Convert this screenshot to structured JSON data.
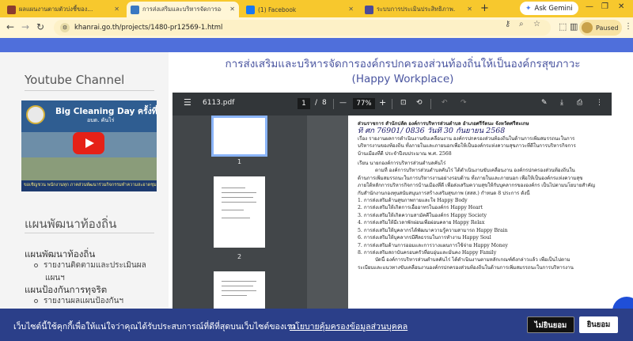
{
  "browser": {
    "tabs": [
      {
        "title": "ผลแผนงานตามตัวบ่งชี้ของ...",
        "icon_color": "#8a3b2f",
        "active": false
      },
      {
        "title": "การส่งเสริมและบริหารจัดการองค์กร",
        "icon_color": "#3a78c2",
        "active": true
      },
      {
        "title": "(1) Facebook",
        "icon_color": "#1877f2",
        "active": false
      },
      {
        "title": "ระบบการประเมินประสิทธิภาพ...",
        "icon_color": "#4a4a9a",
        "active": false
      }
    ],
    "new_tab": "+",
    "ask_gemini": "Ask Gemini",
    "url": "khanrai.go.th/projects/1480-pr12569-1.html",
    "profile_status": "Paused"
  },
  "sidebar": {
    "youtube_heading": "Youtube Channel",
    "video": {
      "title": "Big Cleaning Day ครั้งที่",
      "subtitle": "อบต. คันไร่",
      "caption": "ขอเชิญชวน พนักงานทุก ภาคส่วนพัฒนาร่วมกิจกรรมทำความสะอาดชุมชน ท้องถิ่นของเรา"
    },
    "plan_heading": "แผนพัฒนาท้องถิ่น",
    "items": [
      {
        "label": "แผนพัฒนาท้องถิ่น",
        "sub": [
          "รายงานติดตามและประเมินผล",
          "แผนฯ"
        ]
      },
      {
        "label": "แผนป้องกันการทุจริต",
        "sub": [
          "รายงานผลแผนป้องกันฯ"
        ]
      }
    ]
  },
  "main": {
    "title_line1": "การส่งเสริมและบริหารจัดการองค์กรปกครองส่วนท้องถิ่นให้เป็นองค์กรสุขภาวะ",
    "title_line2": "(Happy Workplace)"
  },
  "pdf": {
    "filename": "6113.pdf",
    "current_page": "1",
    "page_sep": "/",
    "total_pages": "8",
    "zoom": "77%",
    "thumbnails": [
      "1",
      "2"
    ],
    "doc_lines": [
      {
        "text": "ส่วนราชการ     สำนักปลัด องค์การบริหารส่วนตำบล อำเภอศรีรัตนะ จังหวัดศรีสะเกษ",
        "style": "b"
      },
      {
        "text": "ที่  ศก 76901/ 0836                        วันที่  30  กันยายน  2568",
        "style": "hw"
      },
      {
        "text": "เรื่อง   รายงานผลการดำเนินงานขับเคลื่อนงาน องค์กรปกครองส่วนท้องถิ่นในด้านการเพิ่มสมรรถนะในการ",
        "style": ""
      },
      {
        "text": "บริหารงานของท้องถิ่น ทั้งภายในและภายนอกเพื่อให้เป็นองค์กรแห่งความสุขภาวะที่ดีในการบริหารกิจการ",
        "style": ""
      },
      {
        "text": "บ้านเมืองที่ดี ประจำปีงบประมาณ พ.ศ. 2568",
        "style": ""
      },
      {
        "text": "เรียน    นายกองค์การบริหารส่วนตำบลคันไร่",
        "style": ""
      },
      {
        "text": "ตามที่ องค์การบริหารส่วนตำบลคันไร่ ได้ดำเนินงานขับเคลื่อนงาน องค์กรปกครองส่วนท้องถิ่นใน",
        "style": "ind"
      },
      {
        "text": "ด้านการเพิ่มสมรรถนะในการบริหารงานอย่างรอบด้าน ทั้งภายในและภายนอก เพื่อให้เป็นองค์กรแห่งความสุข",
        "style": ""
      },
      {
        "text": "ภายใต้หลักการบริหารกิจการบ้านเมืองที่ดี เพื่อส่งเสริมความสุขให้กับบุคลากรขององค์กร เป็นไปตามนโยบายสำคัญ",
        "style": ""
      },
      {
        "text": "กับสำนักงานกองทุนสนับสนุนการสร้างเสริมสุขภาพ (สสส.) กำหนด 8 ประการ ดังนี้",
        "style": ""
      },
      {
        "text": "1. การส่งเสริมด้านสุขภาพกายและใจ Happy Body",
        "style": ""
      },
      {
        "text": "2. การส่งเสริมให้เกิดการเอื้ออาทรในองค์กร Happy Heart",
        "style": ""
      },
      {
        "text": "3. การส่งเสริมให้เกิดความสามัคคีในองค์กร Happy Society",
        "style": ""
      },
      {
        "text": "4. การส่งเสริมให้มีเวลาพักผ่อนเพื่อผ่อนคลาย Happy Relax",
        "style": ""
      },
      {
        "text": "5. การส่งเสริมให้บุคลากรได้พัฒนาความรู้ความสามารถ Happy Brain",
        "style": ""
      },
      {
        "text": "6. การส่งเสริมให้บุคลากรมีศีลธรรมในการทำงาน Happy Soul",
        "style": ""
      },
      {
        "text": "7. การส่งเสริมด้านการออมและการวางแผนการใช้จ่าย Happy Money",
        "style": ""
      },
      {
        "text": "8. การส่งเสริมสถาบันครอบครัวที่อบอุ่นและมั่นคง Happy Family",
        "style": ""
      },
      {
        "text": "บัดนี้  องค์การบริหารส่วนตำบลคันไร่ ได้ดำเนินงานตามหลักเกณฑ์ดังกล่าวแล้ว เพื่อเป็นไปตาม",
        "style": "ind"
      },
      {
        "text": "ระเบียบและแนวทางขับเคลื่อนงานองค์กรปกครองส่วนท้องถิ่นในด้านการเพิ่มสมรรถนะในการบริหารงาน",
        "style": ""
      }
    ]
  },
  "cookie": {
    "message": "เว็บไซต์นี้ใช้คุกกี้เพื่อให้แน่ใจว่าคุณได้รับประสบการณ์ที่ดีที่สุดบนเว็บไซต์ของเรา",
    "policy_link": "นโยบายคุ้มครองข้อมูลส่วนบุคคล",
    "decline": "ไม่ยินยอม",
    "accept": "ยินยอม"
  },
  "colors": {
    "tabbar": "#f7c82d",
    "accent_blue": "#4f6fdb",
    "cookie_bg": "#2b3f89",
    "title_color": "#4a55a0"
  }
}
